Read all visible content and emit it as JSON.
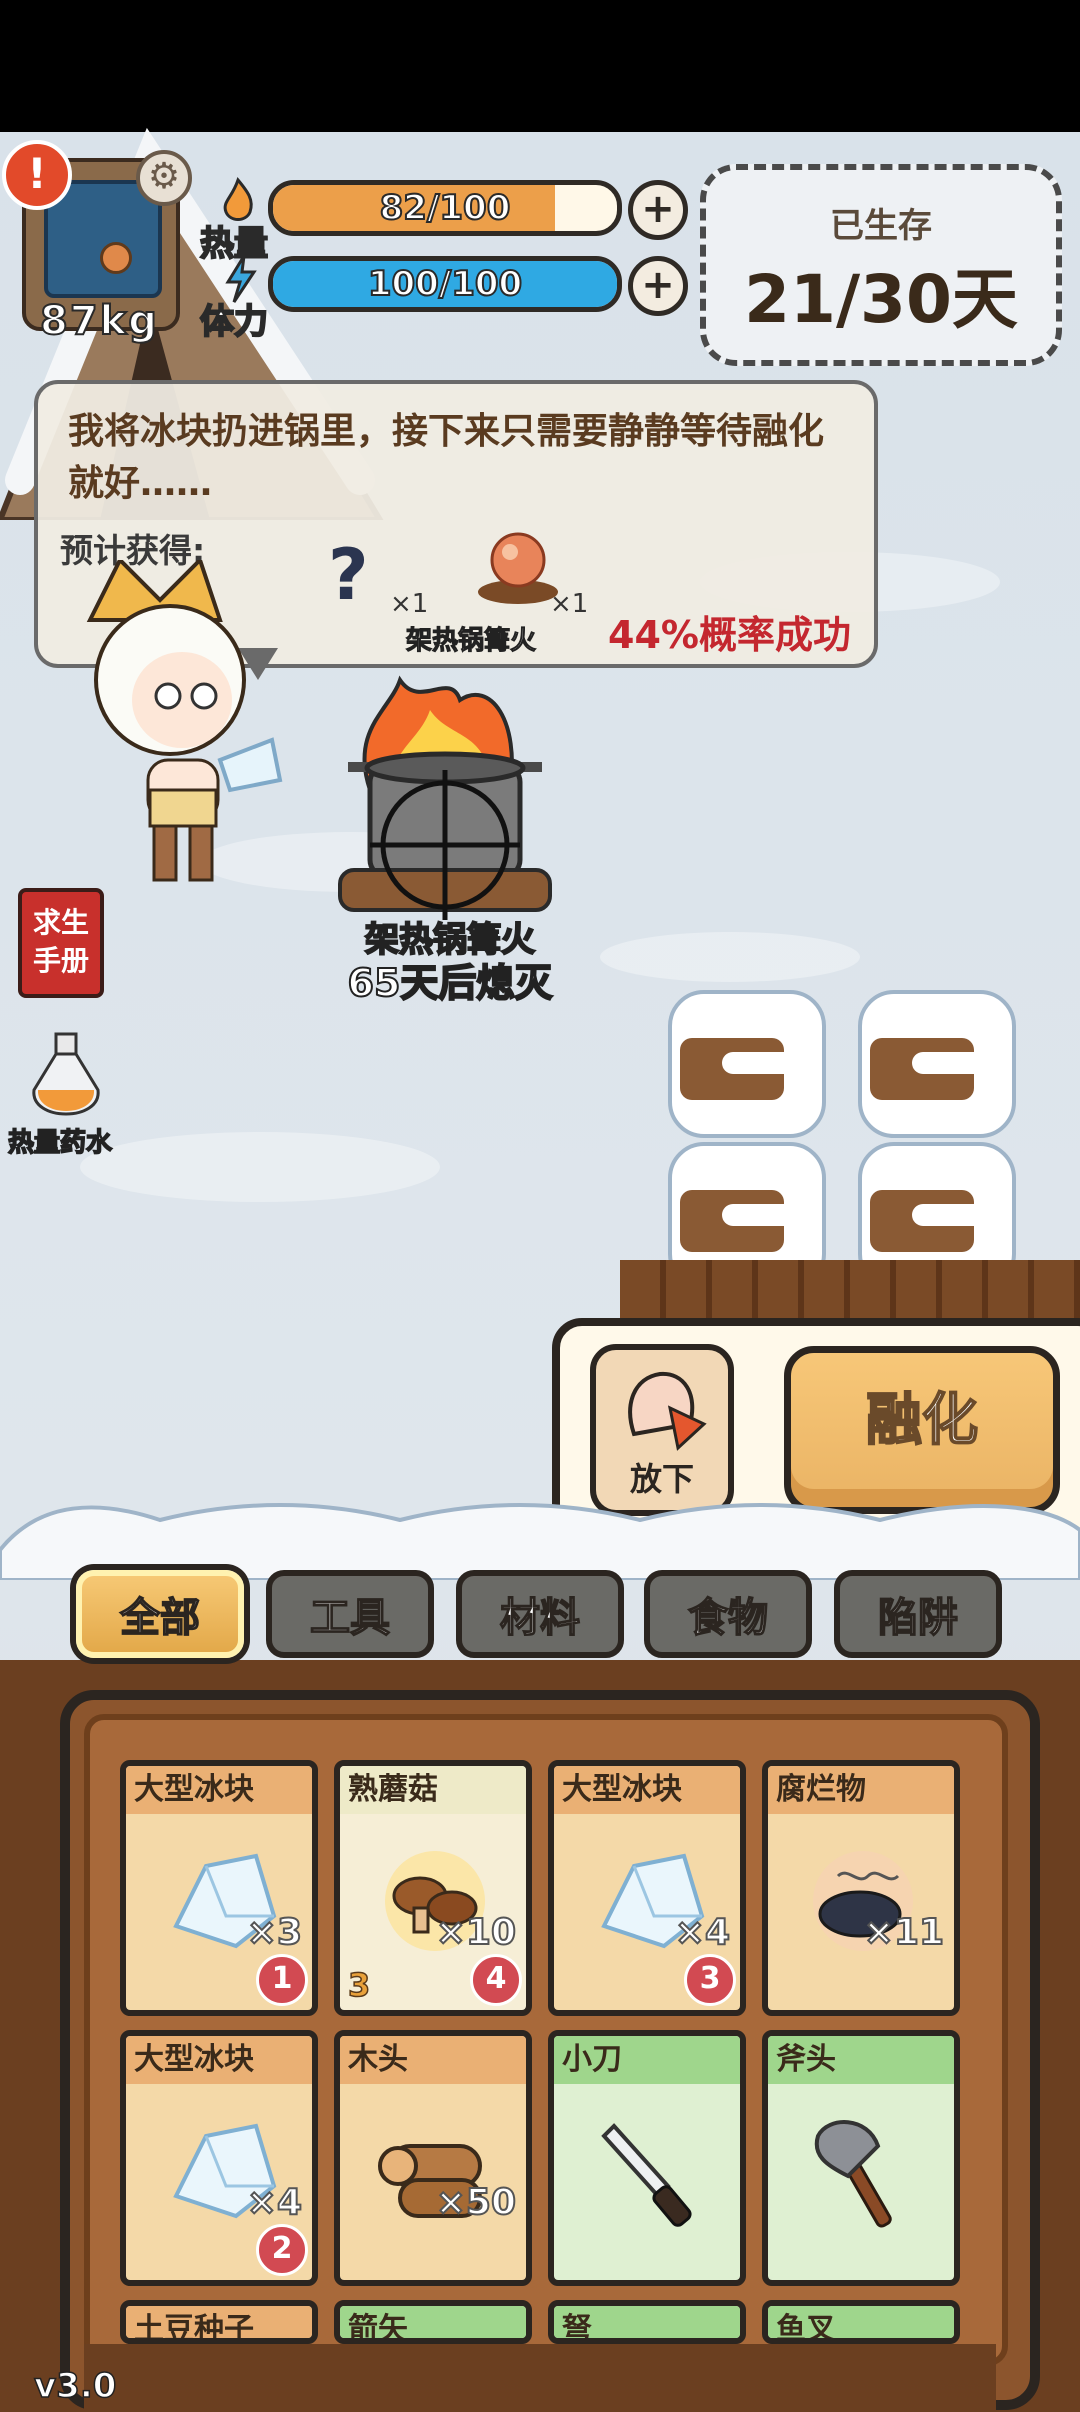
{
  "player": {
    "weight": "87kg",
    "heat_label": "热量",
    "heat_value": "82/100",
    "heat_fraction": 0.82,
    "stamina_label": "体力",
    "stamina_value": "100/100",
    "stamina_fraction": 1.0,
    "plus": "+"
  },
  "survival": {
    "label": "已生存",
    "days": "21/30天"
  },
  "dialog": {
    "message": "我将冰块扔进锅里，接下来只需要静静等待融化就好……",
    "expected_label": "预计获得:",
    "unknown_item": "?",
    "unknown_qty": "×1",
    "fire_qty": "×1",
    "fire_name": "架热锅篝火",
    "chance": "44%概率成功"
  },
  "side_buttons": {
    "handbook": "求生\n手册",
    "potion": "热量药水"
  },
  "campfire": {
    "name": "架热锅篝火",
    "status": "65天后熄灭"
  },
  "actions": {
    "drop": "放下",
    "melt": "融化"
  },
  "tabs": [
    {
      "label": "全部",
      "active": true
    },
    {
      "label": "工具",
      "active": false
    },
    {
      "label": "材料",
      "active": false
    },
    {
      "label": "食物",
      "active": false
    },
    {
      "label": "陷阱",
      "active": false
    }
  ],
  "inventory": [
    {
      "name": "大型冰块",
      "qty": "×3",
      "timer": "1",
      "kind": "ice"
    },
    {
      "name": "熟蘑菇",
      "qty": "×10",
      "timer": "4",
      "timer_left": "3",
      "kind": "mushroom"
    },
    {
      "name": "大型冰块",
      "qty": "×4",
      "timer": "3",
      "kind": "ice"
    },
    {
      "name": "腐烂物",
      "qty": "×11",
      "timer": "",
      "kind": "rotten"
    },
    {
      "name": "大型冰块",
      "qty": "×4",
      "timer": "2",
      "kind": "ice"
    },
    {
      "name": "木头",
      "qty": "×50",
      "timer": "",
      "kind": "wood"
    },
    {
      "name": "小刀",
      "qty": "",
      "timer": "",
      "kind": "knife"
    },
    {
      "name": "斧头",
      "qty": "",
      "timer": "",
      "kind": "axe"
    },
    {
      "name": "土豆种子",
      "qty": "",
      "timer": "",
      "kind": "seed"
    },
    {
      "name": "箭矢",
      "qty": "",
      "timer": "",
      "kind": "arrow"
    },
    {
      "name": "弩",
      "qty": "",
      "timer": "",
      "kind": "crossbow"
    },
    {
      "name": "鱼叉",
      "qty": "",
      "timer": "",
      "kind": "spear"
    }
  ],
  "version": "v3.0"
}
